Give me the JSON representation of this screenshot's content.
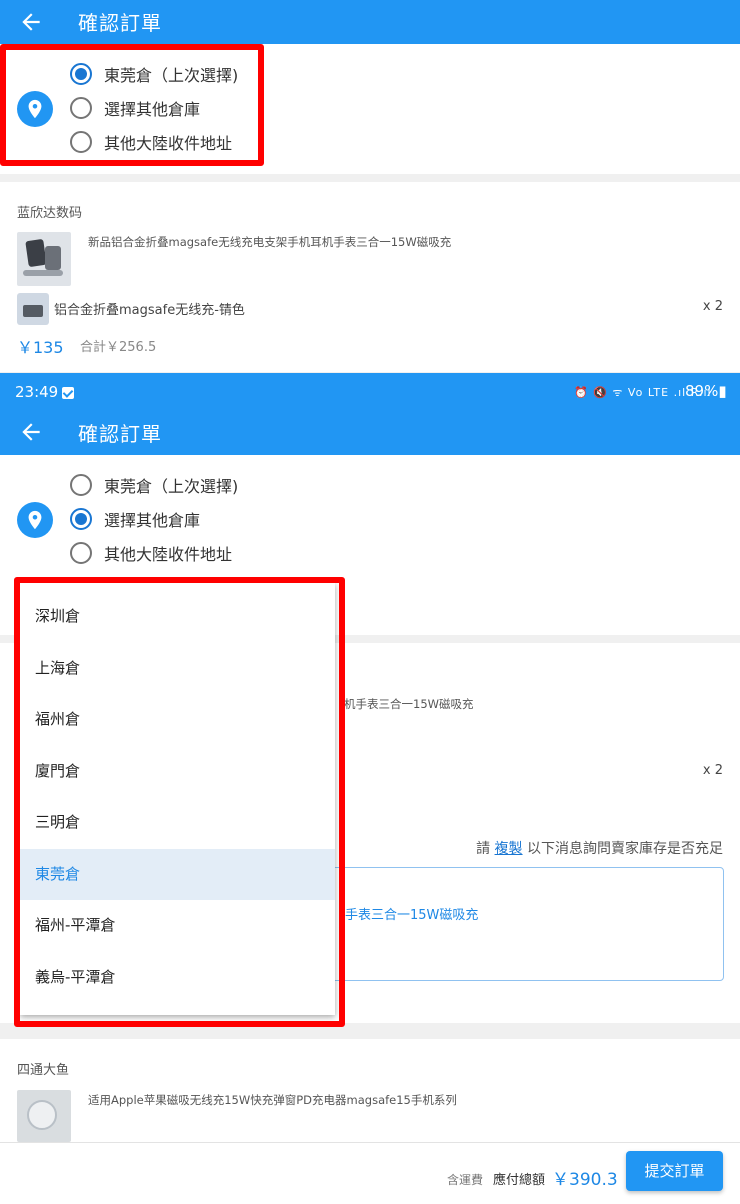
{
  "header": {
    "title": "確認訂單"
  },
  "address_options": [
    {
      "label": "東莞倉（上次選擇)"
    },
    {
      "label": "選擇其他倉庫"
    },
    {
      "label": "其他大陸收件地址"
    }
  ],
  "first_view": {
    "selected_option": 0
  },
  "second_view": {
    "selected_option": 1
  },
  "shop1": {
    "name": "蓝欣达数码",
    "product_title": "新品铝合金折叠magsafe无线充电支架手机耳机手表三合一15W磁吸充",
    "sku": "铝合金折叠magsafe无线充-锖色",
    "qty": "x 2",
    "price": "￥135",
    "subtotal": "合計￥256.5"
  },
  "status_bar": {
    "time": "23:49",
    "icons": "⏰ 🔇 ᯤ Vo LTE .ıl R.ıl",
    "battery": "89%▮"
  },
  "warehouse_dropdown": {
    "items": [
      "深圳倉",
      "上海倉",
      "福州倉",
      "廈門倉",
      "三明倉",
      "東莞倉",
      "福州-平潭倉",
      "義烏-平潭倉"
    ],
    "selected_index": 5
  },
  "behind_dropdown": {
    "product_title_tail": "机手表三合一15W磁吸充",
    "qty": "x 2",
    "hint_prefix": "請",
    "hint_link": "複製",
    "hint_suffix": "以下消息詢問賣家庫存是否充足",
    "message_tail": "手表三合一15W磁吸充"
  },
  "shop2": {
    "name": "四通大鱼",
    "product_title": "适用Apple苹果磁吸无线充15W快充弹窗PD充电器magsafe15手机系列"
  },
  "footer": {
    "shipping_label": "含運費",
    "total_label": "應付總額",
    "total_value": "￥390.3",
    "submit_label": "提交訂單"
  },
  "colors": {
    "primary": "#2196f3",
    "highlight": "#ff0000",
    "price": "#1e88e5"
  }
}
